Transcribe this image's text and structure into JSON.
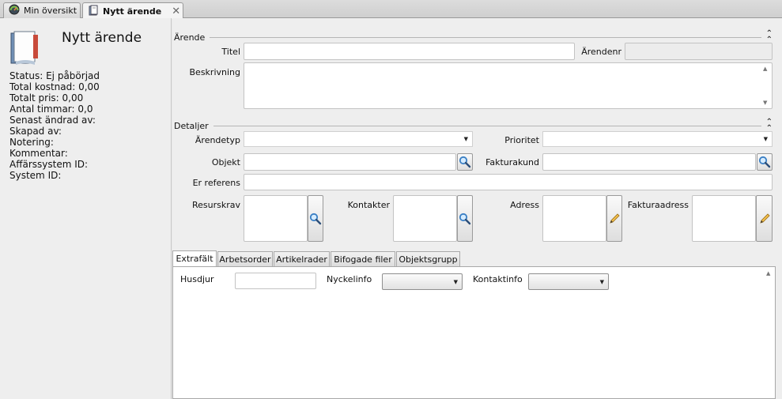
{
  "doc_tabs": [
    {
      "label": "Min översikt",
      "icon": "dashboard-gauge-icon",
      "active": false
    },
    {
      "label": "Nytt ärende",
      "icon": "case-book-icon",
      "active": true,
      "close": "✕"
    }
  ],
  "left": {
    "title": "Nytt ärende",
    "info": [
      "Status: Ej påbörjad",
      "Total kostnad: 0,00",
      "Totalt pris: 0,00",
      "Antal timmar: 0,0",
      "Senast ändrad av:",
      "Skapad av:",
      "Notering:",
      "Kommentar:",
      "Affärssystem ID:",
      "System ID:"
    ]
  },
  "sections": {
    "arende": "Ärende",
    "detaljer": "Detaljer"
  },
  "fields": {
    "titel": {
      "label": "Titel",
      "value": ""
    },
    "arendenr": {
      "label": "Ärendenr",
      "value": ""
    },
    "beskrivning": {
      "label": "Beskrivning",
      "value": ""
    },
    "arendetyp": {
      "label": "Ärendetyp",
      "value": ""
    },
    "prioritet": {
      "label": "Prioritet",
      "value": ""
    },
    "objekt": {
      "label": "Objekt",
      "value": ""
    },
    "fakturakund": {
      "label": "Fakturakund",
      "value": ""
    },
    "er_referens": {
      "label": "Er referens",
      "value": ""
    },
    "resurskrav": {
      "label": "Resurskrav"
    },
    "kontakter": {
      "label": "Kontakter"
    },
    "adress": {
      "label": "Adress"
    },
    "fakturaadress": {
      "label": "Fakturaadress"
    }
  },
  "bottom_tabs": [
    "Extrafält",
    "Arbetsorder",
    "Artikelrader",
    "Bifogade filer",
    "Objektsgrupp"
  ],
  "extra": {
    "husdjur": {
      "label": "Husdjur",
      "value": ""
    },
    "nyckelinfo": {
      "label": "Nyckelinfo",
      "value": ""
    },
    "kontaktinfo": {
      "label": "Kontaktinfo",
      "value": ""
    }
  },
  "colors": {
    "search_glass": "#3a7fc4",
    "pencil": "#e0a020"
  }
}
